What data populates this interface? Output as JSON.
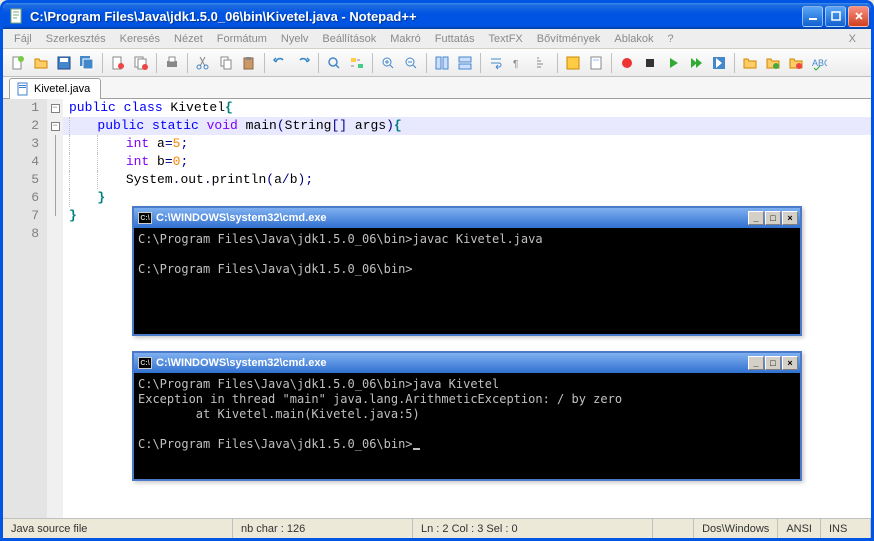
{
  "window": {
    "title": "C:\\Program Files\\Java\\jdk1.5.0_06\\bin\\Kivetel.java - Notepad++"
  },
  "menu": {
    "items": [
      "Fájl",
      "Szerkesztés",
      "Keresés",
      "Nézet",
      "Formátum",
      "Nyelv",
      "Beállítások",
      "Makró",
      "Futtatás",
      "TextFX",
      "Bővítmények",
      "Ablakok",
      "?"
    ],
    "x": "X"
  },
  "toolbar_icons": [
    "new-file-icon",
    "open-folder-icon",
    "save-icon",
    "save-all-icon",
    "sep",
    "close-icon",
    "close-all-icon",
    "sep",
    "print-icon",
    "sep",
    "cut-icon",
    "copy-icon",
    "paste-icon",
    "sep",
    "undo-icon",
    "redo-icon",
    "sep",
    "find-icon",
    "replace-icon",
    "sep",
    "zoom-in-icon",
    "zoom-out-icon",
    "sep",
    "sync-v-icon",
    "sync-h-icon",
    "sep",
    "wordwrap-icon",
    "show-all-icon",
    "indent-guide-icon",
    "sep",
    "lang-icon",
    "doc-map-icon",
    "sep",
    "record-icon",
    "stop-icon",
    "play-icon",
    "play-multi-icon",
    "save-macro-icon",
    "sep",
    "folder-icon",
    "folder-icon-2",
    "folder-icon-3",
    "spell-icon"
  ],
  "tab": {
    "label": "Kivetel.java"
  },
  "code": {
    "lines": [
      {
        "n": 1,
        "fold": "minus",
        "segs": [
          [
            "kw",
            "public "
          ],
          [
            "kw",
            "class "
          ],
          [
            "id",
            "Kivetel"
          ],
          [
            "brace",
            "{"
          ]
        ]
      },
      {
        "n": 2,
        "fold": "minus",
        "hl": true,
        "indent": 1,
        "segs": [
          [
            "kw",
            "public "
          ],
          [
            "kw",
            "static "
          ],
          [
            "type",
            "void "
          ],
          [
            "id",
            "main"
          ],
          [
            "op",
            "("
          ],
          [
            "id",
            "String"
          ],
          [
            "op",
            "[] "
          ],
          [
            "id",
            "args"
          ],
          [
            "op",
            ")"
          ],
          [
            "brace",
            "{"
          ]
        ]
      },
      {
        "n": 3,
        "fold": "line",
        "indent": 2,
        "segs": [
          [
            "type",
            "int "
          ],
          [
            "id",
            "a"
          ],
          [
            "op",
            "="
          ],
          [
            "num",
            "5"
          ],
          [
            "op",
            ";"
          ]
        ]
      },
      {
        "n": 4,
        "fold": "line",
        "indent": 2,
        "segs": [
          [
            "type",
            "int "
          ],
          [
            "id",
            "b"
          ],
          [
            "op",
            "="
          ],
          [
            "num",
            "0"
          ],
          [
            "op",
            ";"
          ]
        ]
      },
      {
        "n": 5,
        "fold": "line",
        "indent": 2,
        "segs": [
          [
            "id",
            "System"
          ],
          [
            "op",
            "."
          ],
          [
            "id",
            "out"
          ],
          [
            "op",
            "."
          ],
          [
            "id",
            "println"
          ],
          [
            "op",
            "("
          ],
          [
            "id",
            "a"
          ],
          [
            "op",
            "/"
          ],
          [
            "id",
            "b"
          ],
          [
            "op",
            ")"
          ],
          [
            "op",
            ";"
          ]
        ]
      },
      {
        "n": 6,
        "fold": "line",
        "indent": 1,
        "segs": [
          [
            "brace",
            "}"
          ]
        ]
      },
      {
        "n": 7,
        "fold": "end",
        "segs": [
          [
            "brace",
            "}"
          ]
        ]
      },
      {
        "n": 8,
        "fold": "",
        "segs": []
      }
    ]
  },
  "console1": {
    "title": "C:\\WINDOWS\\system32\\cmd.exe",
    "icon_label": "C:\\",
    "lines": [
      "C:\\Program Files\\Java\\jdk1.5.0_06\\bin>javac Kivetel.java",
      "",
      "C:\\Program Files\\Java\\jdk1.5.0_06\\bin>"
    ]
  },
  "console2": {
    "title": "C:\\WINDOWS\\system32\\cmd.exe",
    "icon_label": "C:\\",
    "lines": [
      "C:\\Program Files\\Java\\jdk1.5.0_06\\bin>java Kivetel",
      "Exception in thread \"main\" java.lang.ArithmeticException: / by zero",
      "        at Kivetel.main(Kivetel.java:5)",
      "",
      "C:\\Program Files\\Java\\jdk1.5.0_06\\bin>"
    ]
  },
  "status": {
    "filetype": "Java source file",
    "chars": "nb char : 126",
    "pos": "Ln : 2   Col : 3   Sel : 0",
    "eol": "Dos\\Windows",
    "enc": "ANSI",
    "mode": "INS"
  }
}
